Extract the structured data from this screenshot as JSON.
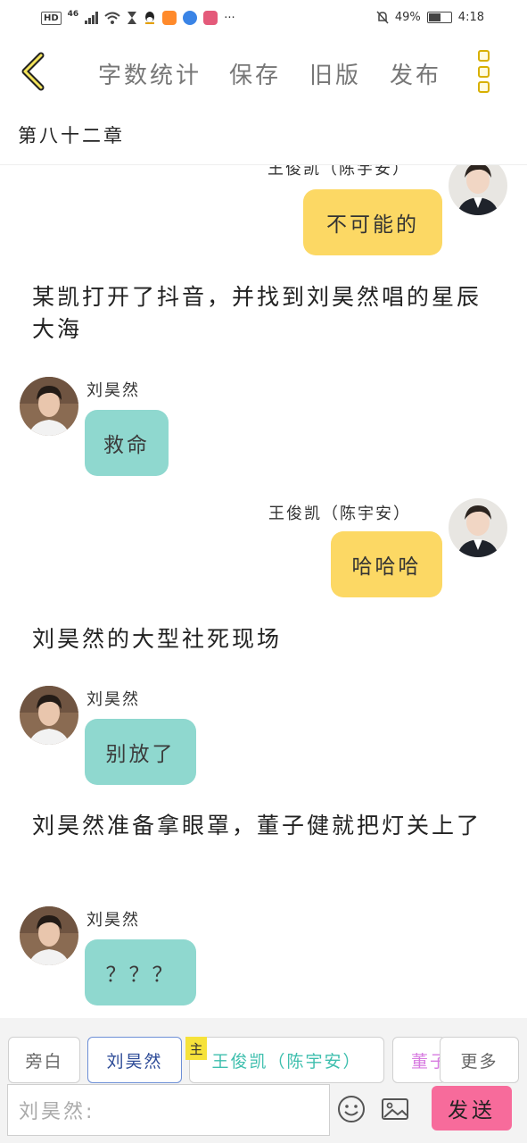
{
  "status_bar": {
    "hd": "HD",
    "network": "46",
    "more": "···",
    "battery_text": "49%",
    "battery_level": 0.49,
    "time": "4:18"
  },
  "toolbar": {
    "back_icon": "chevron-left-icon",
    "word_count": "字数统计",
    "save": "保存",
    "old_version": "旧版",
    "publish": "发布",
    "more_icon": "kebab-menu-icon"
  },
  "chapter": {
    "title": "第八十二章"
  },
  "chat": [
    {
      "type": "right",
      "speaker": "王俊凯（陈宇安）",
      "text": "不可能的"
    },
    {
      "type": "narration",
      "text": "某凯打开了抖音，并找到刘昊然唱的星辰大海"
    },
    {
      "type": "left",
      "speaker": "刘昊然",
      "text": "救命"
    },
    {
      "type": "right",
      "speaker": "王俊凯（陈宇安）",
      "text": "哈哈哈"
    },
    {
      "type": "narration",
      "text": "刘昊然的大型社死现场"
    },
    {
      "type": "left",
      "speaker": "刘昊然",
      "text": "别放了"
    },
    {
      "type": "narration",
      "text": "刘昊然准备拿眼罩，董子健就把灯关上了"
    },
    {
      "type": "left",
      "speaker": "刘昊然",
      "text": "？？？"
    }
  ],
  "roles": {
    "narrator": "旁白",
    "selected": "刘昊然",
    "main_tag": "主",
    "main_role": "王俊凯（陈宇安）",
    "partial_role": "董子",
    "more": "更多"
  },
  "composer": {
    "placeholder": "刘昊然:",
    "emoji_icon": "smiley-icon",
    "image_icon": "image-icon",
    "send": "发送"
  },
  "colors": {
    "right_bubble": "#fcd864",
    "left_bubble": "#8fd8cf",
    "send_button": "#f76b9b",
    "accent_yellow": "#d8b000"
  }
}
